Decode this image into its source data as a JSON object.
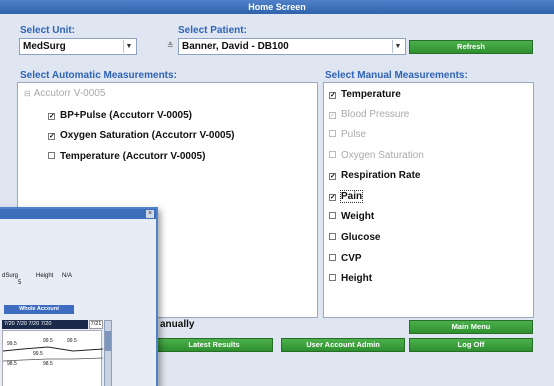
{
  "title": "Home Screen",
  "unit": {
    "label": "Select Unit:",
    "value": "MedSurg"
  },
  "patient": {
    "label": "Select Patient:",
    "value": "Banner, David - DB100"
  },
  "refresh_label": "Refresh",
  "automatic": {
    "label": "Select Automatic Measurements:",
    "device": "Accutorr V-0005",
    "items": [
      {
        "label": "BP+Pulse (Accutorr V-0005)",
        "checked": true
      },
      {
        "label": "Oxygen Saturation (Accutorr V-0005)",
        "checked": true
      },
      {
        "label": "Temperature (Accutorr V-0005)",
        "checked": false
      }
    ]
  },
  "manual": {
    "label": "Select Manual Measurements:",
    "items": [
      {
        "label": "Temperature",
        "checked": true,
        "enabled": true
      },
      {
        "label": "Blood Pressure",
        "checked": true,
        "enabled": false
      },
      {
        "label": "Pulse",
        "checked": false,
        "enabled": false
      },
      {
        "label": "Oxygen Saturation",
        "checked": false,
        "enabled": false
      },
      {
        "label": "Respiration Rate",
        "checked": true,
        "enabled": true
      },
      {
        "label": "Pain",
        "checked": true,
        "enabled": true
      },
      {
        "label": "Weight",
        "checked": false,
        "enabled": true
      },
      {
        "label": "Glucose",
        "checked": false,
        "enabled": true
      },
      {
        "label": "CVP",
        "checked": false,
        "enabled": true
      },
      {
        "label": "Height",
        "checked": false,
        "enabled": true
      }
    ]
  },
  "manually_text": "anually",
  "buttons": {
    "main_menu": "Main Menu",
    "latest_results": "Latest Results",
    "user_account_admin": "User Account Admin",
    "log_off": "Log Off"
  },
  "overlay": {
    "unit": "dSurg",
    "unit_num": "5",
    "height_label": "Height",
    "height_value": "N/A",
    "whole_account": "Whole Account",
    "dates": "7/20  7/20  7/20  7/20",
    "date_last": "7/21",
    "values": [
      "99.5",
      "99.5",
      "99.5",
      "99.5",
      "98.5",
      "98.5"
    ]
  }
}
